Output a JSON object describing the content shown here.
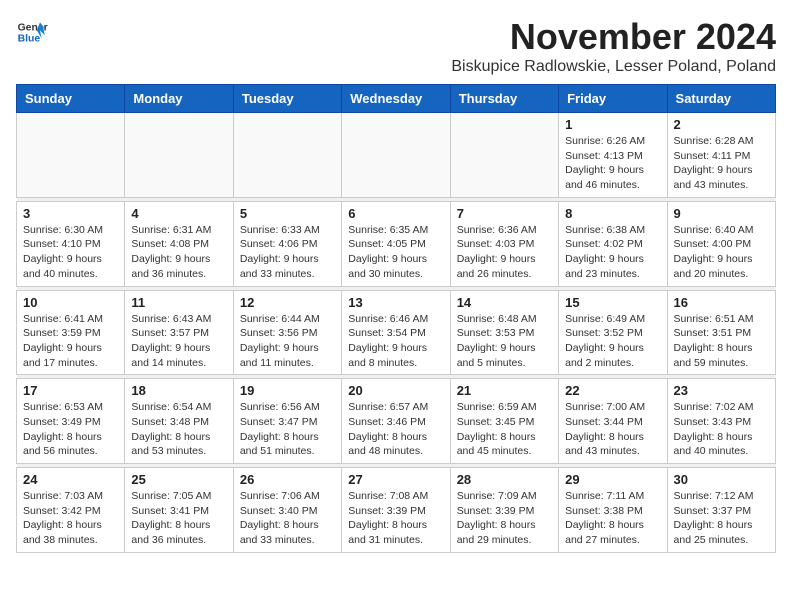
{
  "logo": {
    "general": "General",
    "blue": "Blue"
  },
  "title": "November 2024",
  "location": "Biskupice Radlowskie, Lesser Poland, Poland",
  "weekdays": [
    "Sunday",
    "Monday",
    "Tuesday",
    "Wednesday",
    "Thursday",
    "Friday",
    "Saturday"
  ],
  "weeks": [
    [
      {
        "day": "",
        "info": ""
      },
      {
        "day": "",
        "info": ""
      },
      {
        "day": "",
        "info": ""
      },
      {
        "day": "",
        "info": ""
      },
      {
        "day": "",
        "info": ""
      },
      {
        "day": "1",
        "info": "Sunrise: 6:26 AM\nSunset: 4:13 PM\nDaylight: 9 hours and 46 minutes."
      },
      {
        "day": "2",
        "info": "Sunrise: 6:28 AM\nSunset: 4:11 PM\nDaylight: 9 hours and 43 minutes."
      }
    ],
    [
      {
        "day": "3",
        "info": "Sunrise: 6:30 AM\nSunset: 4:10 PM\nDaylight: 9 hours and 40 minutes."
      },
      {
        "day": "4",
        "info": "Sunrise: 6:31 AM\nSunset: 4:08 PM\nDaylight: 9 hours and 36 minutes."
      },
      {
        "day": "5",
        "info": "Sunrise: 6:33 AM\nSunset: 4:06 PM\nDaylight: 9 hours and 33 minutes."
      },
      {
        "day": "6",
        "info": "Sunrise: 6:35 AM\nSunset: 4:05 PM\nDaylight: 9 hours and 30 minutes."
      },
      {
        "day": "7",
        "info": "Sunrise: 6:36 AM\nSunset: 4:03 PM\nDaylight: 9 hours and 26 minutes."
      },
      {
        "day": "8",
        "info": "Sunrise: 6:38 AM\nSunset: 4:02 PM\nDaylight: 9 hours and 23 minutes."
      },
      {
        "day": "9",
        "info": "Sunrise: 6:40 AM\nSunset: 4:00 PM\nDaylight: 9 hours and 20 minutes."
      }
    ],
    [
      {
        "day": "10",
        "info": "Sunrise: 6:41 AM\nSunset: 3:59 PM\nDaylight: 9 hours and 17 minutes."
      },
      {
        "day": "11",
        "info": "Sunrise: 6:43 AM\nSunset: 3:57 PM\nDaylight: 9 hours and 14 minutes."
      },
      {
        "day": "12",
        "info": "Sunrise: 6:44 AM\nSunset: 3:56 PM\nDaylight: 9 hours and 11 minutes."
      },
      {
        "day": "13",
        "info": "Sunrise: 6:46 AM\nSunset: 3:54 PM\nDaylight: 9 hours and 8 minutes."
      },
      {
        "day": "14",
        "info": "Sunrise: 6:48 AM\nSunset: 3:53 PM\nDaylight: 9 hours and 5 minutes."
      },
      {
        "day": "15",
        "info": "Sunrise: 6:49 AM\nSunset: 3:52 PM\nDaylight: 9 hours and 2 minutes."
      },
      {
        "day": "16",
        "info": "Sunrise: 6:51 AM\nSunset: 3:51 PM\nDaylight: 8 hours and 59 minutes."
      }
    ],
    [
      {
        "day": "17",
        "info": "Sunrise: 6:53 AM\nSunset: 3:49 PM\nDaylight: 8 hours and 56 minutes."
      },
      {
        "day": "18",
        "info": "Sunrise: 6:54 AM\nSunset: 3:48 PM\nDaylight: 8 hours and 53 minutes."
      },
      {
        "day": "19",
        "info": "Sunrise: 6:56 AM\nSunset: 3:47 PM\nDaylight: 8 hours and 51 minutes."
      },
      {
        "day": "20",
        "info": "Sunrise: 6:57 AM\nSunset: 3:46 PM\nDaylight: 8 hours and 48 minutes."
      },
      {
        "day": "21",
        "info": "Sunrise: 6:59 AM\nSunset: 3:45 PM\nDaylight: 8 hours and 45 minutes."
      },
      {
        "day": "22",
        "info": "Sunrise: 7:00 AM\nSunset: 3:44 PM\nDaylight: 8 hours and 43 minutes."
      },
      {
        "day": "23",
        "info": "Sunrise: 7:02 AM\nSunset: 3:43 PM\nDaylight: 8 hours and 40 minutes."
      }
    ],
    [
      {
        "day": "24",
        "info": "Sunrise: 7:03 AM\nSunset: 3:42 PM\nDaylight: 8 hours and 38 minutes."
      },
      {
        "day": "25",
        "info": "Sunrise: 7:05 AM\nSunset: 3:41 PM\nDaylight: 8 hours and 36 minutes."
      },
      {
        "day": "26",
        "info": "Sunrise: 7:06 AM\nSunset: 3:40 PM\nDaylight: 8 hours and 33 minutes."
      },
      {
        "day": "27",
        "info": "Sunrise: 7:08 AM\nSunset: 3:39 PM\nDaylight: 8 hours and 31 minutes."
      },
      {
        "day": "28",
        "info": "Sunrise: 7:09 AM\nSunset: 3:39 PM\nDaylight: 8 hours and 29 minutes."
      },
      {
        "day": "29",
        "info": "Sunrise: 7:11 AM\nSunset: 3:38 PM\nDaylight: 8 hours and 27 minutes."
      },
      {
        "day": "30",
        "info": "Sunrise: 7:12 AM\nSunset: 3:37 PM\nDaylight: 8 hours and 25 minutes."
      }
    ]
  ]
}
